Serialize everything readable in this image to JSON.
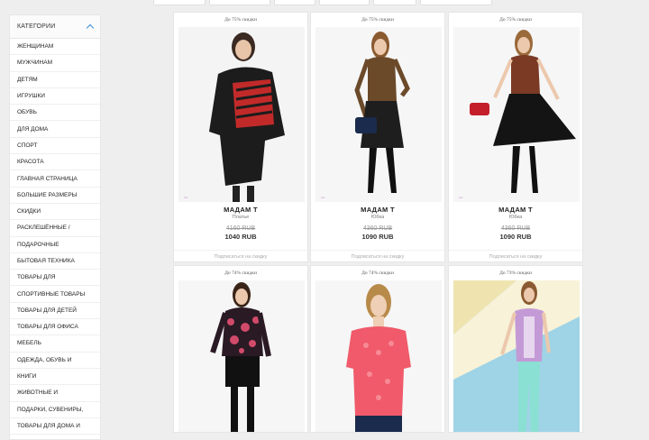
{
  "sidebar": {
    "title": "КАТЕГОРИИ",
    "items": [
      {
        "label": "ЖЕНЩИНАМ"
      },
      {
        "label": "МУЖЧИНАМ"
      },
      {
        "label": "ДЕТЯМ"
      },
      {
        "label": "ИГРУШКИ"
      },
      {
        "label": "ОБУВЬ"
      },
      {
        "label": "ДЛЯ ДОМА"
      },
      {
        "label": "СПОРТ"
      },
      {
        "label": "КРАСОТА"
      },
      {
        "label": "ГЛАВНАЯ СТРАНИЦА"
      },
      {
        "label": "БОЛЬШИЕ РАЗМЕРЫ"
      },
      {
        "label": "СКИДКИ"
      },
      {
        "label": "РАСКЛЕШЁННЫЕ /"
      },
      {
        "label": "ПОДАРОЧНЫЕ"
      },
      {
        "label": "БЫТОВАЯ ТЕХНИКА"
      },
      {
        "label": "ТОВАРЫ ДЛЯ"
      },
      {
        "label": "СПОРТИВНЫЕ ТОВАРЫ"
      },
      {
        "label": "ТОВАРЫ ДЛЯ ДЕТЕЙ"
      },
      {
        "label": "ТОВАРЫ ДЛЯ ОФИСА"
      },
      {
        "label": "МЕБЕЛЬ"
      },
      {
        "label": "ОДЕЖДА, ОБУВЬ И"
      },
      {
        "label": "КНИГИ"
      },
      {
        "label": "ЖИВОТНЫЕ И"
      },
      {
        "label": "ПОДАРКИ, СУВЕНИРЫ,"
      },
      {
        "label": "ТОВАРЫ ДЛЯ ДОМА И"
      }
    ]
  },
  "products": [
    {
      "discount": "До 75% скидки",
      "brand": "МАДАМ Т",
      "type": "Платье",
      "old_price": "4160 RUB",
      "price": "1040 RUB",
      "subscribe": "Подписаться на скидку"
    },
    {
      "discount": "До 75% скидки",
      "brand": "МАДАМ Т",
      "type": "Юбка",
      "old_price": "4360 RUB",
      "price": "1090 RUB",
      "subscribe": "Подписаться на скидку"
    },
    {
      "discount": "До 75% скидки",
      "brand": "МАДАМ Т",
      "type": "Юбка",
      "old_price": "4360 RUB",
      "price": "1090 RUB",
      "subscribe": "Подписаться на скидку"
    },
    {
      "discount": "До 74% скидки"
    },
    {
      "discount": "До 74% скидки"
    },
    {
      "discount": "До 73% скидки"
    }
  ],
  "colors": {
    "accent": "#3a8fd8",
    "background": "#eeeeee"
  }
}
